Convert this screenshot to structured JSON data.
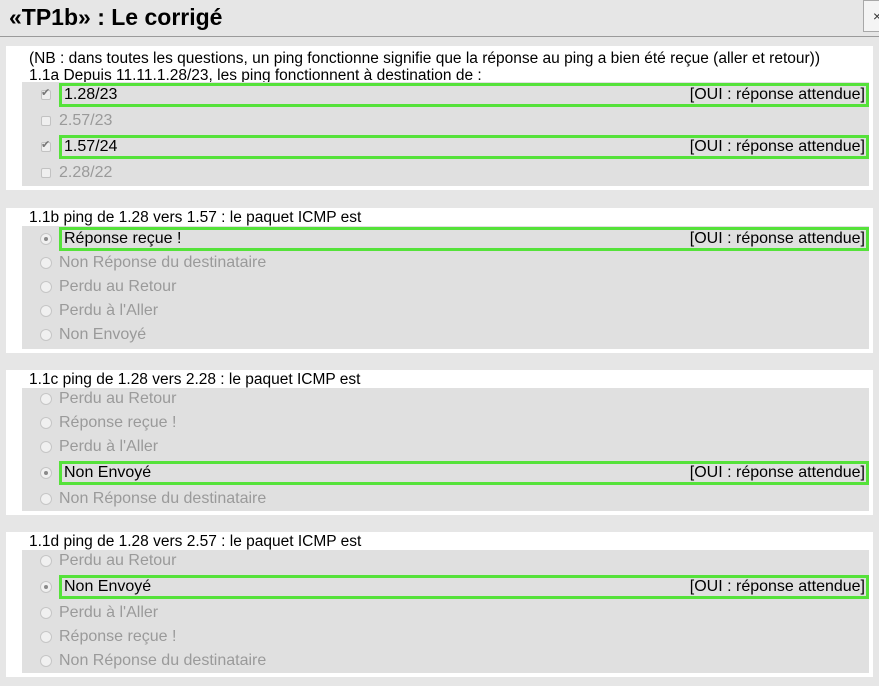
{
  "header": {
    "title": "«TP1b» : Le corrigé",
    "close_label": "×"
  },
  "questions": [
    {
      "lines": [
        "(NB : dans toutes les questions, un ping fonctionne signifie que la réponse au ping a bien été reçue (aller et retour))",
        "1.1a Depuis 11.11.1.28/23, les ping fonctionnent à destination de :"
      ],
      "type": "checkbox",
      "options": [
        {
          "label": "1.28/23",
          "checked": true,
          "feedback": "[OUI : réponse attendue]"
        },
        {
          "label": "2.57/23",
          "checked": false,
          "feedback": ""
        },
        {
          "label": "1.57/24",
          "checked": true,
          "feedback": "[OUI : réponse attendue]"
        },
        {
          "label": "2.28/22",
          "checked": false,
          "feedback": ""
        }
      ]
    },
    {
      "lines": [
        "1.1b ping de 1.28 vers 1.57 : le paquet ICMP est"
      ],
      "type": "radio",
      "options": [
        {
          "label": "Réponse reçue !",
          "checked": true,
          "feedback": "[OUI : réponse attendue]"
        },
        {
          "label": "Non Réponse du destinataire",
          "checked": false,
          "feedback": ""
        },
        {
          "label": "Perdu au Retour",
          "checked": false,
          "feedback": ""
        },
        {
          "label": "Perdu à l'Aller",
          "checked": false,
          "feedback": ""
        },
        {
          "label": "Non Envoyé",
          "checked": false,
          "feedback": ""
        }
      ]
    },
    {
      "lines": [
        "1.1c ping de 1.28 vers 2.28 : le paquet ICMP est"
      ],
      "type": "radio",
      "options": [
        {
          "label": "Perdu au Retour",
          "checked": false,
          "feedback": ""
        },
        {
          "label": "Réponse reçue !",
          "checked": false,
          "feedback": ""
        },
        {
          "label": "Perdu à l'Aller",
          "checked": false,
          "feedback": ""
        },
        {
          "label": "Non Envoyé",
          "checked": true,
          "feedback": "[OUI : réponse attendue]"
        },
        {
          "label": "Non Réponse du destinataire",
          "checked": false,
          "feedback": ""
        }
      ]
    },
    {
      "lines": [
        "1.1d ping de 1.28 vers 2.57 : le paquet ICMP est"
      ],
      "type": "radio",
      "options": [
        {
          "label": "Perdu au Retour",
          "checked": false,
          "feedback": ""
        },
        {
          "label": "Non Envoyé",
          "checked": true,
          "feedback": "[OUI : réponse attendue]"
        },
        {
          "label": "Perdu à l'Aller",
          "checked": false,
          "feedback": ""
        },
        {
          "label": "Réponse reçue !",
          "checked": false,
          "feedback": ""
        },
        {
          "label": "Non Réponse du destinataire",
          "checked": false,
          "feedback": ""
        }
      ]
    }
  ]
}
